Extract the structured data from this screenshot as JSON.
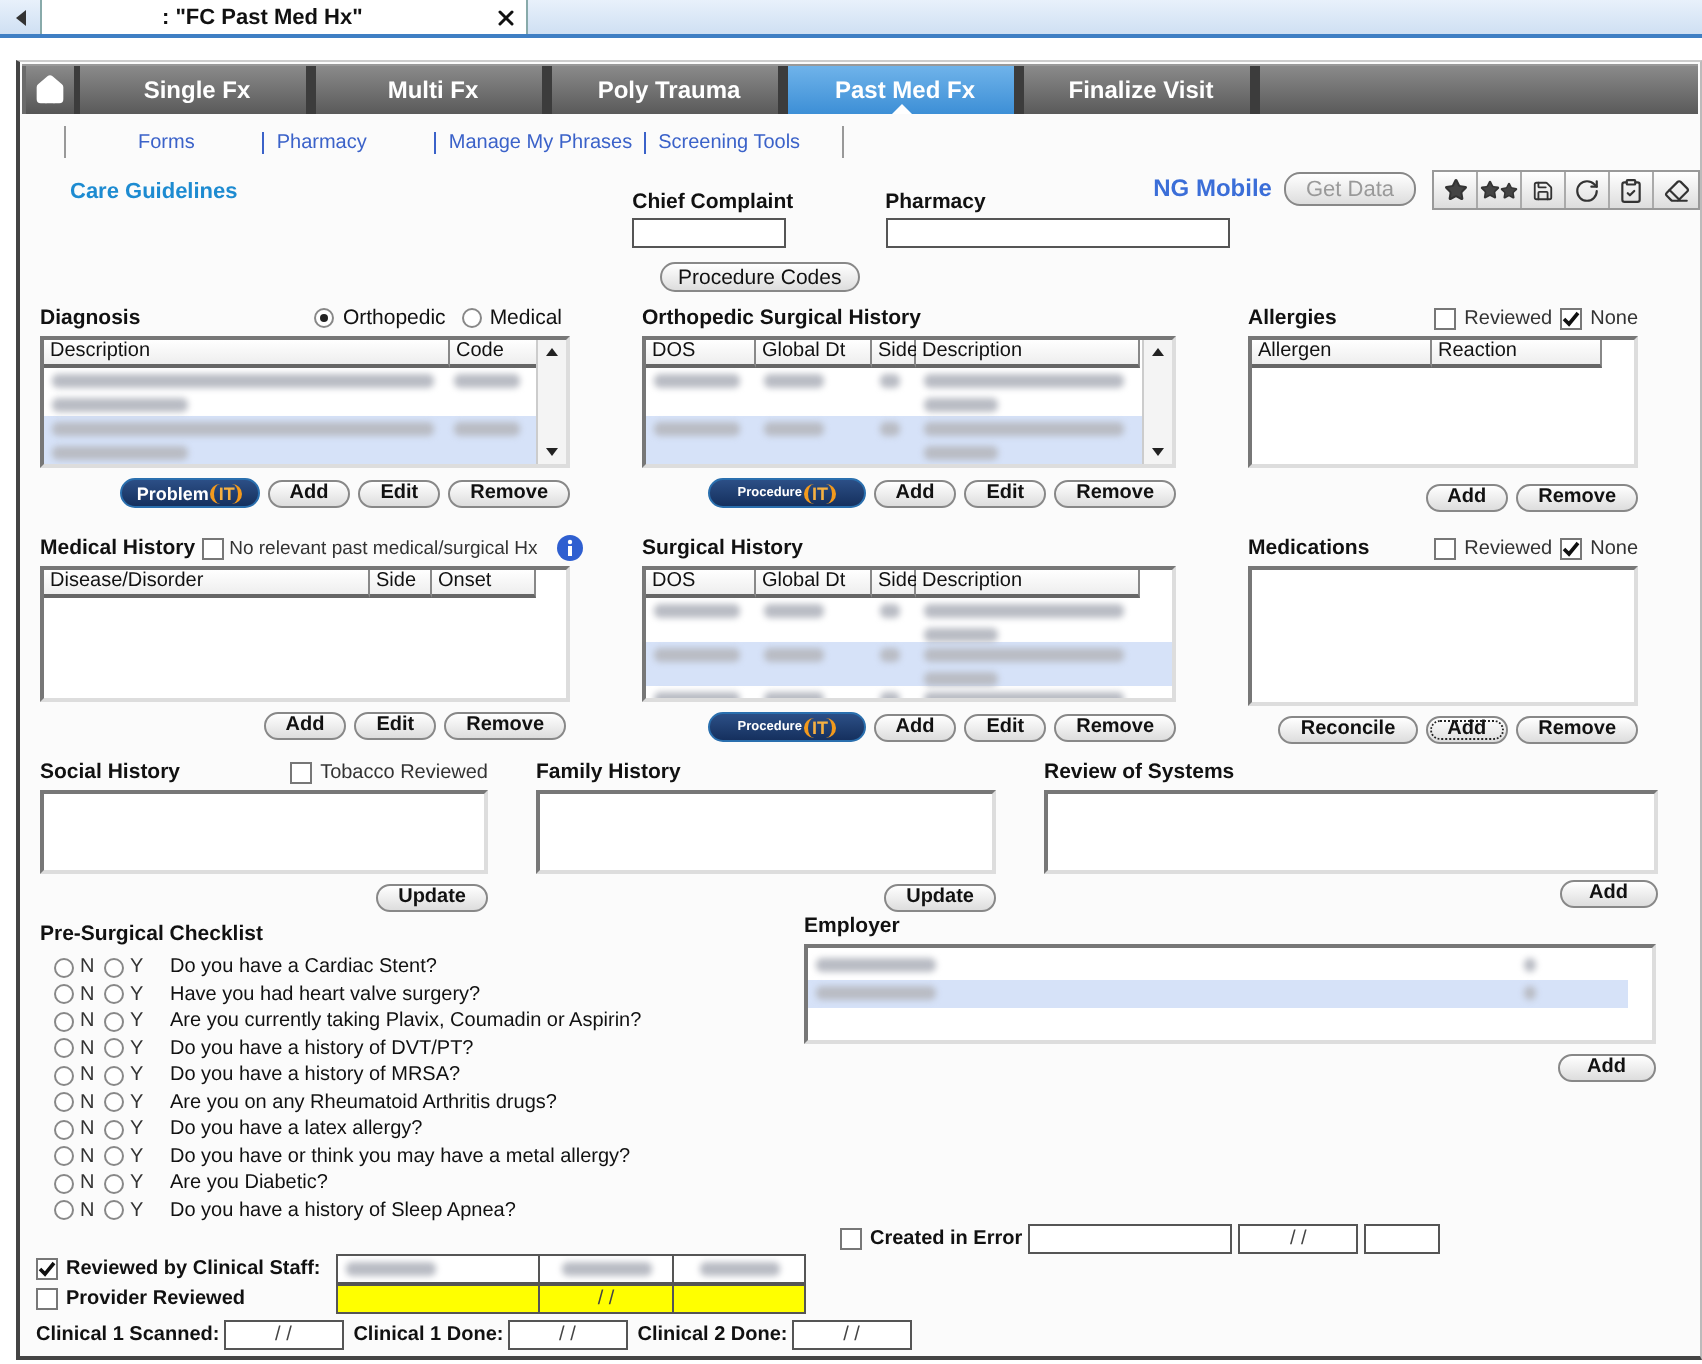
{
  "document_tab": {
    "title": ": \"FC Past Med Hx\""
  },
  "nav_tabs": [
    {
      "label": "Single Fx",
      "selected": false
    },
    {
      "label": "Multi Fx",
      "selected": false
    },
    {
      "label": "Poly Trauma",
      "selected": false
    },
    {
      "label": "Past Med Fx",
      "selected": true
    },
    {
      "label": "Finalize Visit",
      "selected": false
    }
  ],
  "links": [
    "Forms",
    "Pharmacy",
    "Manage My Phrases",
    "Screening Tools"
  ],
  "care_guidelines": "Care Guidelines",
  "chief_complaint": {
    "label": "Chief Complaint"
  },
  "pharmacy": {
    "label": "Pharmacy"
  },
  "ng_mobile": "NG Mobile",
  "get_data": {
    "label": "Get Data",
    "disabled": true
  },
  "procedure_codes": "Procedure Codes",
  "diagnosis": {
    "title": "Diagnosis",
    "options": [
      {
        "label": "Orthopedic",
        "selected": true
      },
      {
        "label": "Medical",
        "selected": false
      }
    ],
    "columns": [
      "Description",
      "Code"
    ],
    "rows": [
      {
        "selected": false
      },
      {
        "selected": true
      }
    ],
    "logo": {
      "word": "Problem",
      "badge": "IT"
    },
    "buttons": [
      "Add",
      "Edit",
      "Remove"
    ]
  },
  "ortho_surgical_history": {
    "title": "Orthopedic Surgical History",
    "columns": [
      "DOS",
      "Global Dt",
      "Side",
      "Description"
    ],
    "rows": [
      {
        "selected": false
      },
      {
        "selected": true
      }
    ],
    "logo": {
      "word": "Procedure",
      "badge": "IT"
    },
    "buttons": [
      "Add",
      "Edit",
      "Remove"
    ]
  },
  "allergies": {
    "title": "Allergies",
    "checks": [
      {
        "label": "Reviewed",
        "checked": false
      },
      {
        "label": "None",
        "checked": true
      }
    ],
    "columns": [
      "Allergen",
      "Reaction"
    ],
    "buttons": [
      "Add",
      "Remove"
    ]
  },
  "medical_history": {
    "title": "Medical History",
    "no_relevant": {
      "label": "No relevant past medical/surgical Hx",
      "checked": false
    },
    "columns": [
      "Disease/Disorder",
      "Side",
      "Onset"
    ],
    "buttons": [
      "Add",
      "Edit",
      "Remove"
    ]
  },
  "surgical_history": {
    "title": "Surgical History",
    "columns": [
      "DOS",
      "Global Dt",
      "Side",
      "Description"
    ],
    "rows": [
      {
        "selected": false
      },
      {
        "selected": true
      },
      {
        "selected": false
      }
    ],
    "logo": {
      "word": "Procedure",
      "badge": "IT"
    },
    "buttons": [
      "Add",
      "Edit",
      "Remove"
    ]
  },
  "medications": {
    "title": "Medications",
    "checks": [
      {
        "label": "Reviewed",
        "checked": false
      },
      {
        "label": "None",
        "checked": true
      }
    ],
    "buttons": [
      {
        "label": "Reconcile",
        "focused": false
      },
      {
        "label": "Add",
        "focused": true
      },
      {
        "label": "Remove",
        "focused": false
      }
    ]
  },
  "social_history": {
    "title": "Social History",
    "tobacco_reviewed": {
      "label": "Tobacco Reviewed",
      "checked": false
    },
    "button": "Update"
  },
  "family_history": {
    "title": "Family History",
    "button": "Update"
  },
  "review_of_systems": {
    "title": "Review of Systems",
    "button": "Add"
  },
  "pre_surgical_checklist": {
    "title": "Pre-Surgical Checklist",
    "questions": [
      {
        "options": [
          {
            "label": "N",
            "selected": false
          },
          {
            "label": "Y",
            "selected": false
          }
        ],
        "text": "Do you have a Cardiac Stent?"
      },
      {
        "options": [
          {
            "label": "N",
            "selected": false
          },
          {
            "label": "Y",
            "selected": false
          }
        ],
        "text": "Have you had heart valve surgery?"
      },
      {
        "options": [
          {
            "label": "N",
            "selected": false
          },
          {
            "label": "Y",
            "selected": false
          }
        ],
        "text": "Are you currently taking Plavix, Coumadin or Aspirin?"
      },
      {
        "options": [
          {
            "label": "N",
            "selected": false
          },
          {
            "label": "Y",
            "selected": false
          }
        ],
        "text": "Do you have a history of DVT/PT?"
      },
      {
        "options": [
          {
            "label": "N",
            "selected": false
          },
          {
            "label": "Y",
            "selected": false
          }
        ],
        "text": "Do you have a history of MRSA?"
      },
      {
        "options": [
          {
            "label": "N",
            "selected": false
          },
          {
            "label": "Y",
            "selected": false
          }
        ],
        "text": "Are you on any Rheumatoid Arthritis drugs?"
      },
      {
        "options": [
          {
            "label": "N",
            "selected": false
          },
          {
            "label": "Y",
            "selected": false
          }
        ],
        "text": "Do you have a latex allergy?"
      },
      {
        "options": [
          {
            "label": "N",
            "selected": false
          },
          {
            "label": "Y",
            "selected": false
          }
        ],
        "text": "Do you have or think you may have a metal allergy?"
      },
      {
        "options": [
          {
            "label": "N",
            "selected": false
          },
          {
            "label": "Y",
            "selected": false
          }
        ],
        "text": "Are you Diabetic?"
      },
      {
        "options": [
          {
            "label": "N",
            "selected": false
          },
          {
            "label": "Y",
            "selected": false
          }
        ],
        "text": "Do you have a history of Sleep Apnea?"
      }
    ]
  },
  "employer": {
    "title": "Employer",
    "rows": [
      {
        "selected": false
      },
      {
        "selected": true
      }
    ],
    "button": "Add"
  },
  "created_in_error": {
    "label": "Created in Error",
    "checked": false,
    "date": "/ /"
  },
  "reviewed_by_clinical_staff": {
    "label": "Reviewed by Clinical Staff:",
    "checked": true
  },
  "provider_reviewed": {
    "label": "Provider Reviewed",
    "checked": false,
    "date": "/ /"
  },
  "clinical_dates": [
    {
      "label": "Clinical 1 Scanned:",
      "value": "/ /"
    },
    {
      "label": "Clinical 1 Done:",
      "value": "/ /"
    },
    {
      "label": "Clinical 2 Done:",
      "value": "/ /"
    }
  ]
}
